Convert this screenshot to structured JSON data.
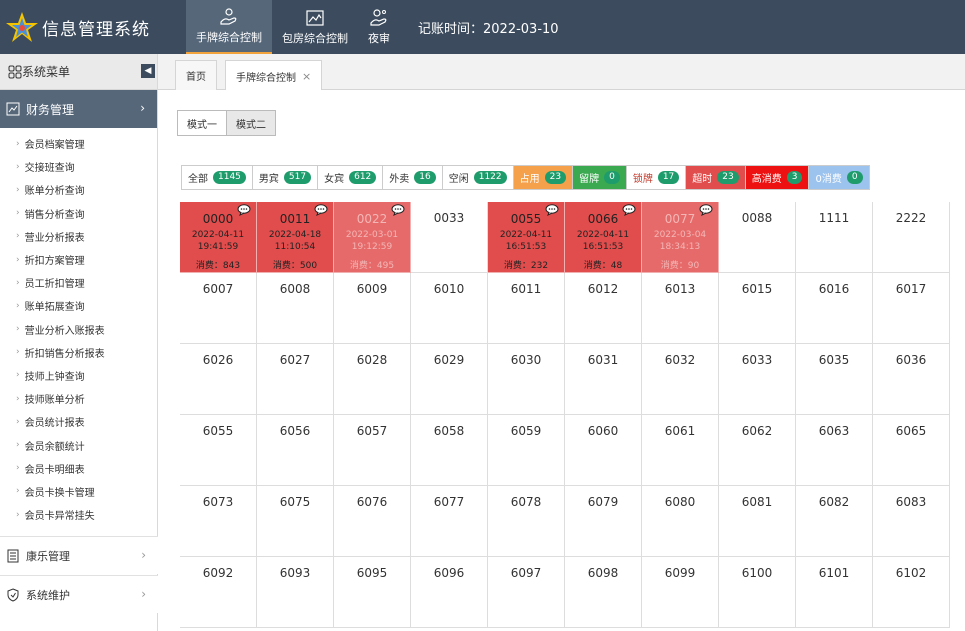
{
  "app": {
    "title": "信息管理系统",
    "account_time": "记账时间：2022-03-10"
  },
  "topnav": [
    {
      "label": "手牌综合控制",
      "icon": "hand-card-icon",
      "active": true
    },
    {
      "label": "包房综合控制",
      "icon": "room-icon",
      "active": false
    },
    {
      "label": "夜审",
      "icon": "night-audit-icon",
      "active": false
    }
  ],
  "sidebar": {
    "title": "系统菜单",
    "group_finance": "财务管理",
    "items": [
      "会员档案管理",
      "交接班查询",
      "账单分析查询",
      "销售分析查询",
      "营业分析报表",
      "折扣方案管理",
      "员工折扣管理",
      "账单拓展查询",
      "营业分析入账报表",
      "折扣销售分析报表",
      "技师上钟查询",
      "技师账单分析",
      "会员统计报表",
      "会员余额统计",
      "会员卡明细表",
      "会员卡换卡管理",
      "会员卡异常挂失"
    ],
    "group_leisure": "康乐管理",
    "group_system": "系统维护"
  },
  "tabs": [
    {
      "label": "首页",
      "active": false
    },
    {
      "label": "手牌综合控制",
      "active": true
    }
  ],
  "modes": [
    "模式一",
    "模式二"
  ],
  "legend": [
    {
      "label": "全部",
      "count": "1145",
      "bg": "#ffffff",
      "color": "#333333"
    },
    {
      "label": "男宾",
      "count": "517",
      "bg": "#ffffff",
      "color": "#333333"
    },
    {
      "label": "女宾",
      "count": "612",
      "bg": "#ffffff",
      "color": "#333333"
    },
    {
      "label": "外卖",
      "count": "16",
      "bg": "#ffffff",
      "color": "#333333"
    },
    {
      "label": "空闲",
      "count": "1122",
      "bg": "#ffffff",
      "color": "#333333"
    },
    {
      "label": "占用",
      "count": "23",
      "bg": "#f5a04a",
      "color": "#ffffff"
    },
    {
      "label": "留牌",
      "count": "0",
      "bg": "#3aa94f",
      "color": "#ffffff"
    },
    {
      "label": "锁牌",
      "count": "17",
      "bg": "#ffffff",
      "color": "#c0392b"
    },
    {
      "label": "超时",
      "count": "23",
      "bg": "#e14d4d",
      "color": "#ffffff"
    },
    {
      "label": "高消费",
      "count": "3",
      "bg": "#ee1111",
      "color": "#ffffff"
    },
    {
      "label": "0消费",
      "count": "0",
      "bg": "#9cc3ee",
      "color": "#ffffff"
    }
  ],
  "cost_label": "消费：",
  "grid": [
    [
      {
        "no": "0000",
        "occ": true,
        "date": "2022-04-11",
        "time": "19:41:59",
        "cost": "843"
      },
      {
        "no": "0011",
        "occ": true,
        "date": "2022-04-18",
        "time": "11:10:54",
        "cost": "500"
      },
      {
        "no": "0022",
        "occ": true,
        "faded": true,
        "date": "2022-03-01",
        "time": "19:12:59",
        "cost": "495"
      },
      {
        "no": "0033"
      },
      {
        "no": "0055",
        "occ": true,
        "date": "2022-04-11",
        "time": "16:51:53",
        "cost": "232"
      },
      {
        "no": "0066",
        "occ": true,
        "date": "2022-04-11",
        "time": "16:51:53",
        "cost": "48"
      },
      {
        "no": "0077",
        "occ": true,
        "faded": true,
        "date": "2022-03-04",
        "time": "18:34:13",
        "cost": "90"
      },
      {
        "no": "0088"
      },
      {
        "no": "1111"
      },
      {
        "no": "2222"
      }
    ],
    [
      {
        "no": "6007"
      },
      {
        "no": "6008"
      },
      {
        "no": "6009"
      },
      {
        "no": "6010"
      },
      {
        "no": "6011"
      },
      {
        "no": "6012"
      },
      {
        "no": "6013"
      },
      {
        "no": "6015"
      },
      {
        "no": "6016"
      },
      {
        "no": "6017"
      }
    ],
    [
      {
        "no": "6026"
      },
      {
        "no": "6027"
      },
      {
        "no": "6028"
      },
      {
        "no": "6029"
      },
      {
        "no": "6030"
      },
      {
        "no": "6031"
      },
      {
        "no": "6032"
      },
      {
        "no": "6033"
      },
      {
        "no": "6035"
      },
      {
        "no": "6036"
      }
    ],
    [
      {
        "no": "6055"
      },
      {
        "no": "6056"
      },
      {
        "no": "6057"
      },
      {
        "no": "6058"
      },
      {
        "no": "6059"
      },
      {
        "no": "6060"
      },
      {
        "no": "6061"
      },
      {
        "no": "6062"
      },
      {
        "no": "6063"
      },
      {
        "no": "6065"
      }
    ],
    [
      {
        "no": "6073"
      },
      {
        "no": "6075"
      },
      {
        "no": "6076"
      },
      {
        "no": "6077"
      },
      {
        "no": "6078"
      },
      {
        "no": "6079"
      },
      {
        "no": "6080"
      },
      {
        "no": "6081"
      },
      {
        "no": "6082"
      },
      {
        "no": "6083"
      }
    ],
    [
      {
        "no": "6092"
      },
      {
        "no": "6093"
      },
      {
        "no": "6095"
      },
      {
        "no": "6096"
      },
      {
        "no": "6097"
      },
      {
        "no": "6098"
      },
      {
        "no": "6099"
      },
      {
        "no": "6100"
      },
      {
        "no": "6101"
      },
      {
        "no": "6102"
      }
    ]
  ]
}
